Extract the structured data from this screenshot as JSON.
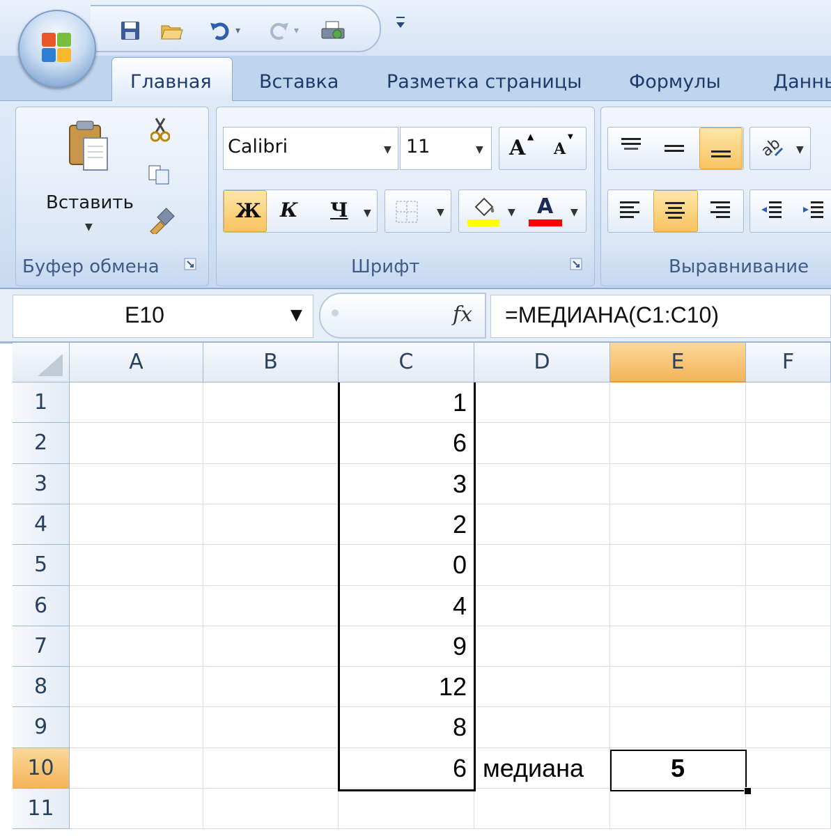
{
  "quick_access": {
    "icons": [
      "save-icon",
      "open-folder-icon",
      "undo-icon",
      "redo-icon",
      "print-preview-icon"
    ]
  },
  "tabs": [
    "Главная",
    "Вставка",
    "Разметка страницы",
    "Формулы",
    "Данны"
  ],
  "ribbon": {
    "clipboard": {
      "paste_label": "Вставить",
      "group_label": "Буфер обмена"
    },
    "font": {
      "font_name": "Calibri",
      "font_size": "11",
      "grow_label": "A",
      "shrink_label": "A",
      "bold_label": "Ж",
      "italic_label": "К",
      "underline_label": "Ч",
      "font_color_label": "A",
      "group_label": "Шрифт",
      "fill_color": "#ffff00",
      "font_color": "#ff0000"
    },
    "alignment": {
      "group_label": "Выравнивание"
    }
  },
  "formula_bar": {
    "name_box": "E10",
    "fx_label": "fx",
    "formula": "=МЕДИАНА(C1:C10)"
  },
  "sheet": {
    "columns": [
      "A",
      "B",
      "C",
      "D",
      "E",
      "F"
    ],
    "selected_column": "E",
    "rows": [
      "1",
      "2",
      "3",
      "4",
      "5",
      "6",
      "7",
      "8",
      "9",
      "10",
      "11"
    ],
    "selected_row": "10",
    "column_c_values": [
      "1",
      "6",
      "3",
      "2",
      "0",
      "4",
      "9",
      "12",
      "8",
      "6"
    ],
    "d10_label": "медиана",
    "e10_value": "5"
  },
  "colors": {
    "accent": "#f4b459",
    "ribbon": "#dbe7f6"
  }
}
